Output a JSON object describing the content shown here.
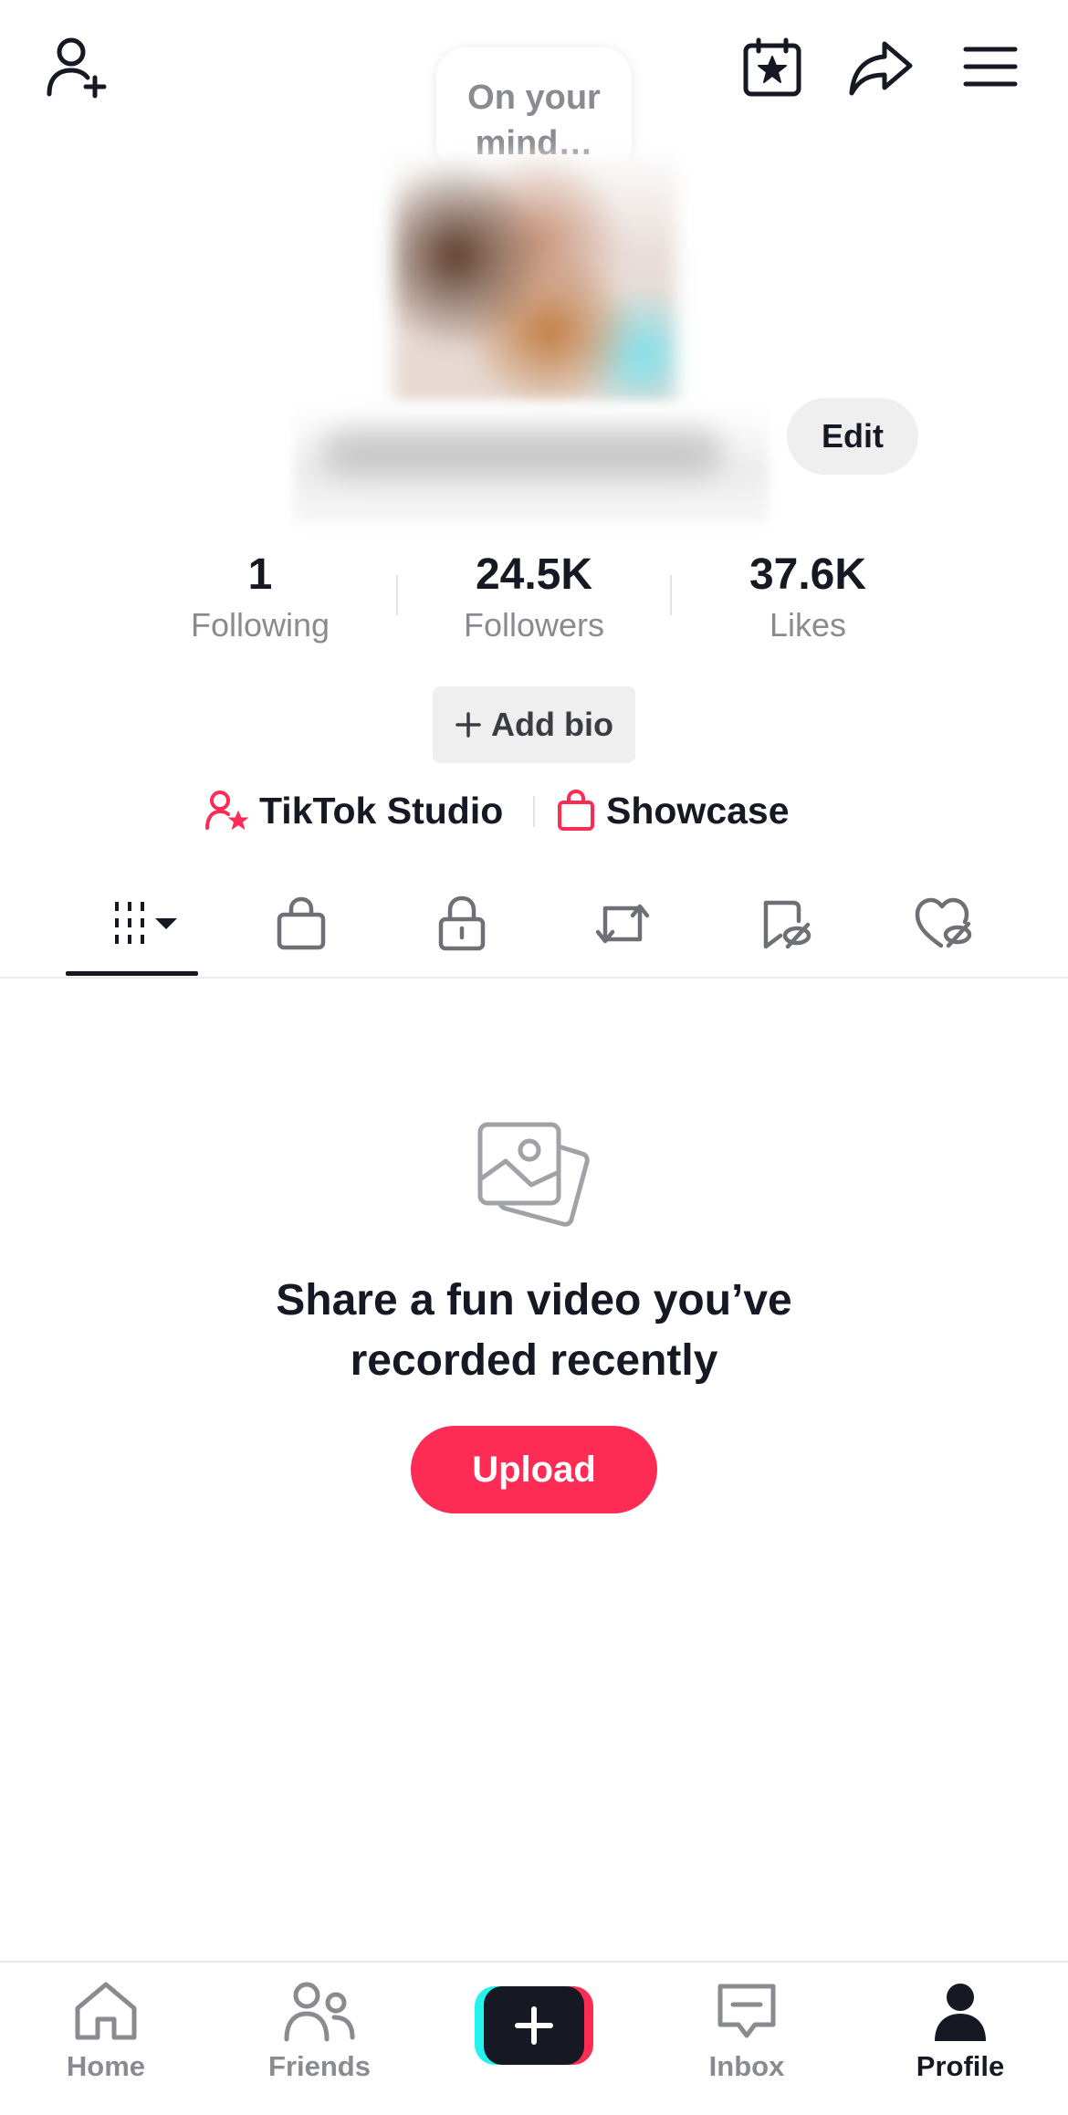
{
  "header": {
    "add_friend_icon": "person-plus-icon",
    "calendar_icon": "calendar-star-icon",
    "share_icon": "share-arrow-icon",
    "menu_icon": "hamburger-menu-icon"
  },
  "profile": {
    "thought_bubble": "On your mind…",
    "edit_label": "Edit",
    "add_bio_label": "Add bio"
  },
  "stats": [
    {
      "value": "1",
      "label": "Following"
    },
    {
      "value": "24.5K",
      "label": "Followers"
    },
    {
      "value": "37.6K",
      "label": "Likes"
    }
  ],
  "links": {
    "studio_label": "TikTok Studio",
    "showcase_label": "Showcase"
  },
  "tabs": [
    {
      "name": "videos",
      "icon": "grid-columns-icon",
      "active": true
    },
    {
      "name": "shop",
      "icon": "shopping-bag-icon"
    },
    {
      "name": "private",
      "icon": "lock-icon"
    },
    {
      "name": "reposts",
      "icon": "repost-icon"
    },
    {
      "name": "favorites",
      "icon": "bookmark-hidden-icon"
    },
    {
      "name": "liked",
      "icon": "heart-hidden-icon"
    }
  ],
  "empty_state": {
    "title_line1": "Share a fun video you’ve",
    "title_line2": "recorded recently",
    "upload_label": "Upload"
  },
  "bottom_nav": {
    "home": "Home",
    "friends": "Friends",
    "inbox": "Inbox",
    "profile": "Profile"
  },
  "colors": {
    "accent": "#fe2c55",
    "cyan": "#25f4ee",
    "text": "#161823",
    "muted": "#8a8b91"
  }
}
